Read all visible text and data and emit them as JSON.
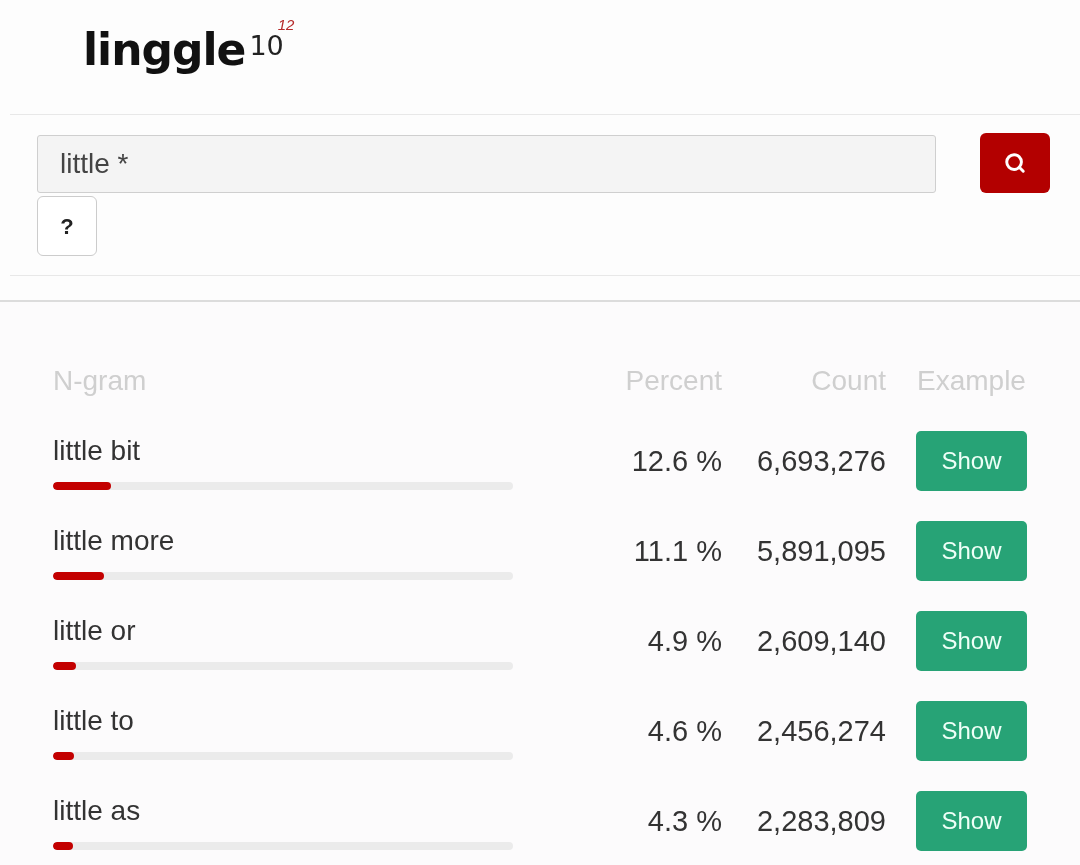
{
  "logo": {
    "name": "linggle",
    "base": "10",
    "exponent": "12"
  },
  "search": {
    "value": "little *"
  },
  "help_button": {
    "label": "?"
  },
  "table": {
    "columns": [
      "N-gram",
      "Percent",
      "Count",
      "Example"
    ],
    "rows": [
      {
        "ngram": "little bit",
        "level": 0.126,
        "percent": "12.6 %",
        "count": "6,693,276",
        "action": "Show"
      },
      {
        "ngram": "little more",
        "level": 0.111,
        "percent": "11.1 %",
        "count": "5,891,095",
        "action": "Show"
      },
      {
        "ngram": "little or",
        "level": 0.049,
        "percent": "4.9 %",
        "count": "2,609,140",
        "action": "Show"
      },
      {
        "ngram": "little to",
        "level": 0.046,
        "percent": "4.6 %",
        "count": "2,456,274",
        "action": "Show"
      },
      {
        "ngram": "little as",
        "level": 0.043,
        "percent": "4.3 %",
        "count": "2,283,809",
        "action": "Show"
      }
    ]
  }
}
